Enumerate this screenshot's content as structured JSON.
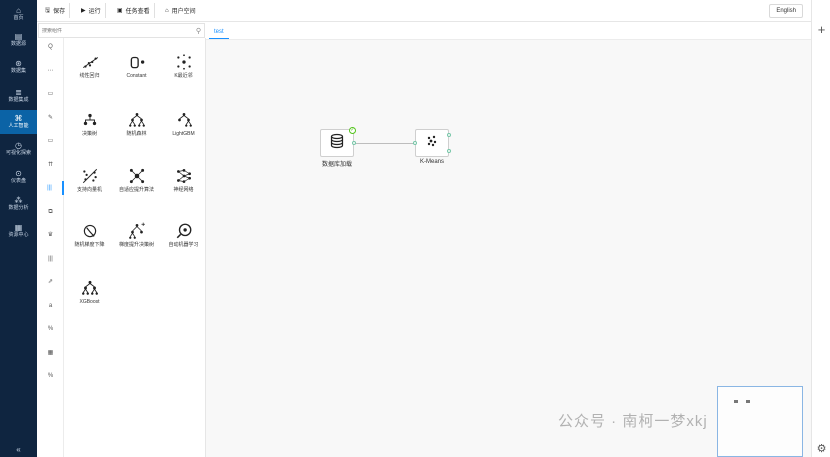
{
  "nav": {
    "items": [
      {
        "icon": "⌂",
        "label": "首页"
      },
      {
        "icon": "▤",
        "label": "数据源"
      },
      {
        "icon": "⊛",
        "label": "数据集"
      },
      {
        "icon": "≣",
        "label": "数据集成"
      },
      {
        "icon": "⌘",
        "label": "人工智能"
      },
      {
        "icon": "◷",
        "label": "可视化探索"
      },
      {
        "icon": "⊙",
        "label": "仪表盘"
      },
      {
        "icon": "⁂",
        "label": "数据分析"
      },
      {
        "icon": "▦",
        "label": "资源中心"
      }
    ],
    "active_index": 4,
    "collapse_icon": "«"
  },
  "toolbar": {
    "save_label": "保存",
    "run_label": "运行",
    "task_label": "任务查看",
    "user_space_label": "用户空间",
    "language_label": "English"
  },
  "search": {
    "placeholder": "搜索组件"
  },
  "categories": [
    "Q",
    "⋯",
    "▭",
    "✎",
    "▭",
    "⇈",
    "|||",
    "⧉",
    "♛",
    "|||",
    "⇗",
    "a",
    "%",
    "▦",
    "%"
  ],
  "active_category_index": 6,
  "components": [
    {
      "label": "线性回归",
      "icon": "linear-regression-icon"
    },
    {
      "label": "Constant",
      "icon": "constant-icon"
    },
    {
      "label": "K最近邻",
      "icon": "knn-icon"
    },
    {
      "label": "决策树",
      "icon": "decision-tree-icon"
    },
    {
      "label": "随机森林",
      "icon": "random-forest-icon"
    },
    {
      "label": "LightGBM",
      "icon": "lightgbm-icon"
    },
    {
      "label": "支持向量机",
      "icon": "svm-icon"
    },
    {
      "label": "自适应提升算法",
      "icon": "adaboost-icon"
    },
    {
      "label": "神经网络",
      "icon": "neural-network-icon"
    },
    {
      "label": "随机梯度下降",
      "icon": "sgd-icon"
    },
    {
      "label": "梯度提升决策树",
      "icon": "gbdt-icon"
    },
    {
      "label": "自动机器学习",
      "icon": "automl-icon"
    },
    {
      "label": "XGBoost",
      "icon": "xgboost-icon"
    }
  ],
  "canvas": {
    "tab_label": "test",
    "nodes": [
      {
        "label": "数据库加载",
        "icon": "database-icon"
      },
      {
        "label": "K-Means",
        "icon": "kmeans-icon"
      }
    ]
  },
  "watermark": "公众号 · 南柯一梦xkj",
  "colors": {
    "nav_bg": "#0f2540",
    "nav_active": "#0b63a6",
    "accent": "#1890ff",
    "port": "#76c6a8"
  }
}
